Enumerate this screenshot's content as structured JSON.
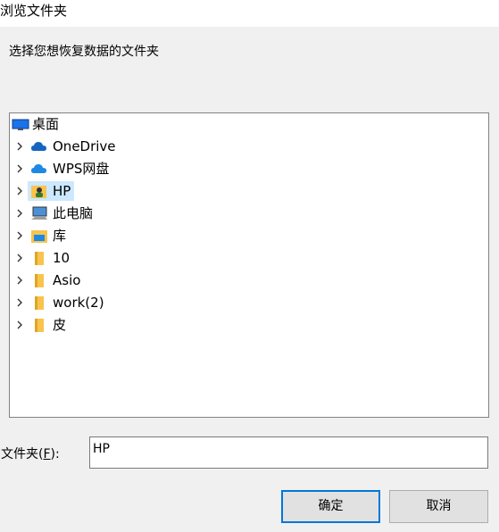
{
  "dialog": {
    "title": "浏览文件夹",
    "instruction": "选择您想恢复数据的文件夹"
  },
  "tree": {
    "root": {
      "label": "桌面",
      "icon": "desktop-icon"
    },
    "items": [
      {
        "label": "OneDrive",
        "icon": "cloud-icon",
        "selected": false
      },
      {
        "label": "WPS网盘",
        "icon": "cloud-icon",
        "selected": false
      },
      {
        "label": "HP",
        "icon": "user-folder-icon",
        "selected": true
      },
      {
        "label": "此电脑",
        "icon": "computer-icon",
        "selected": false
      },
      {
        "label": "库",
        "icon": "library-icon",
        "selected": false
      },
      {
        "label": "10",
        "icon": "folder-icon",
        "selected": false
      },
      {
        "label": "Asio",
        "icon": "folder-icon",
        "selected": false
      },
      {
        "label": "work(2)",
        "icon": "folder-icon",
        "selected": false
      },
      {
        "label": "皮",
        "icon": "folder-icon",
        "selected": false
      }
    ]
  },
  "folder_field": {
    "label_prefix": "文件夹(",
    "label_key": "F",
    "label_suffix": "):",
    "value": "HP"
  },
  "buttons": {
    "ok": "确定",
    "cancel": "取消"
  },
  "colors": {
    "selection": "#cce8ff",
    "default_button_border": "#0078d7",
    "folder": "#f8c44e",
    "cloud": "#1565c0"
  }
}
